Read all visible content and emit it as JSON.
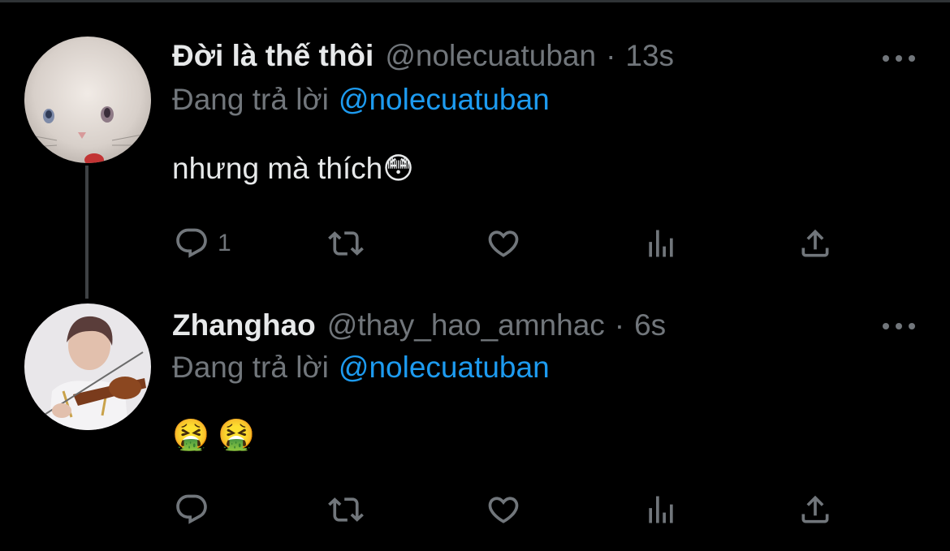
{
  "tweets": [
    {
      "display_name": "Đời là thế thôi",
      "handle": "@nolecuatuban",
      "separator": "·",
      "time": "13s",
      "reply_prefix": "Đang trả lời",
      "reply_to": "@nolecuatuban",
      "text": "nhưng mà thích😳",
      "reply_count": "1",
      "avatar": "white-cat-avatar"
    },
    {
      "display_name": "Zhanghao",
      "handle": "@thay_hao_amnhac",
      "separator": "·",
      "time": "6s",
      "reply_prefix": "Đang trả lời",
      "reply_to": "@nolecuatuban",
      "text": "🤮 🤮",
      "reply_count": "",
      "avatar": "violinist-avatar"
    }
  ],
  "icons": [
    "reply-icon",
    "retweet-icon",
    "like-icon",
    "views-icon",
    "share-icon",
    "more-icon"
  ],
  "colors": {
    "background": "#000000",
    "primary_text": "#e7e9ea",
    "secondary_text": "#71767b",
    "mention": "#1d9bf0"
  }
}
